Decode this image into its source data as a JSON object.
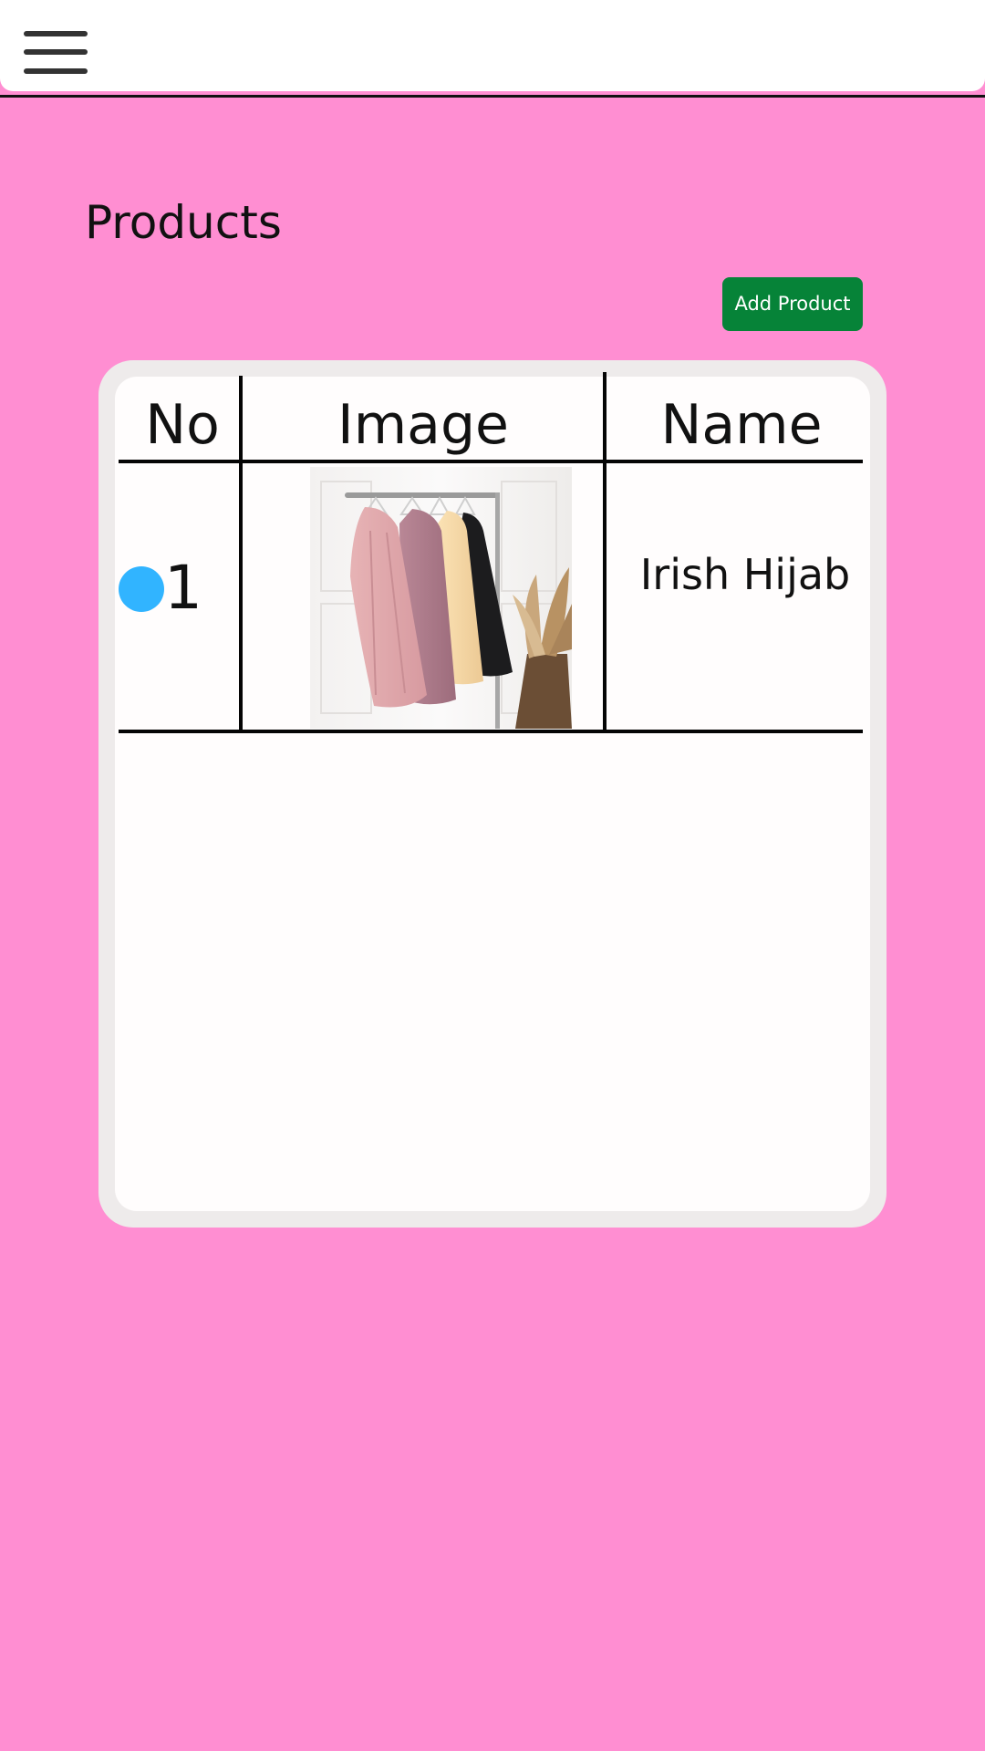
{
  "header": {
    "menu_icon": "hamburger-menu-icon"
  },
  "page": {
    "title": "Products",
    "add_button_label": "Add Product"
  },
  "table": {
    "columns": [
      "No",
      "Image",
      "Name"
    ],
    "rows": [
      {
        "no": "1",
        "status_color": "#31b4ff",
        "image": "clothing-rack-image",
        "name": "Irish Hijab"
      }
    ]
  },
  "colors": {
    "background": "#ff8ed2",
    "add_button": "#068338",
    "status_dot": "#31b4ff"
  }
}
